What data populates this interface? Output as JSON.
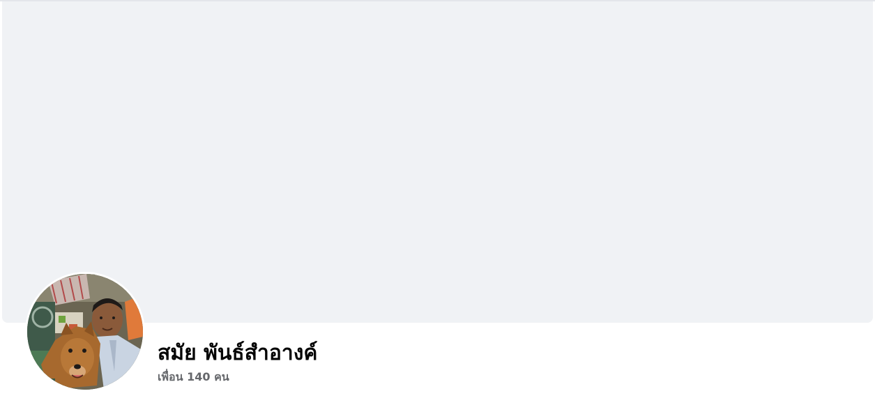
{
  "profile": {
    "name": "สมัย พันธ์สำอางค์",
    "friends_count": "เพื่อน 140 คน"
  },
  "avatar": {
    "description_icon": "profile-photo"
  },
  "colors": {
    "cover": "#f0f2f5",
    "name": "#050505",
    "secondary": "#65676b"
  }
}
